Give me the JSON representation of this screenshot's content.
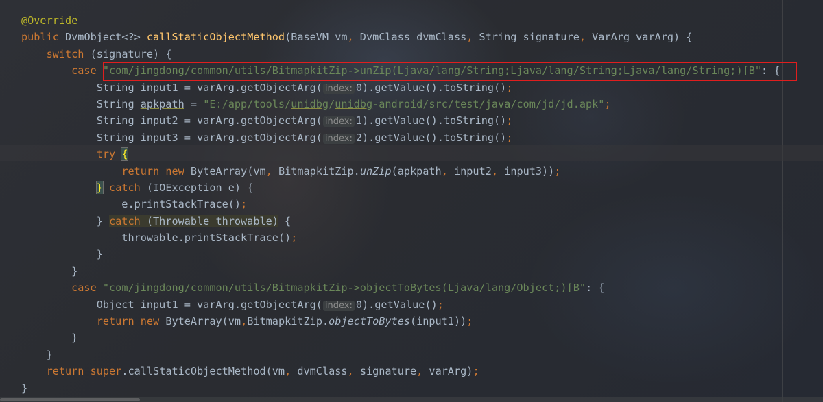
{
  "editor": {
    "language": "java",
    "current_line_index": 8,
    "highlighted_line_index": 3,
    "colors": {
      "keyword": "#cc7832",
      "string": "#6a8759",
      "method_declaration": "#ffc66d",
      "annotation": "#bbb529",
      "plain": "#a9b7c6",
      "param_hint_text": "#8d8d8d",
      "highlight_box": "#e01e1e"
    },
    "lines": [
      {
        "tokens": [
          {
            "t": "@Override",
            "c": "ann"
          }
        ]
      },
      {
        "tokens": [
          {
            "t": "public",
            "c": "kw"
          },
          {
            "t": " DvmObject<?> "
          },
          {
            "t": "callStaticObjectMethod",
            "c": "fn"
          },
          {
            "t": "(BaseVM vm"
          },
          {
            "t": ",",
            "c": "kw"
          },
          {
            "t": " DvmClass dvmClass"
          },
          {
            "t": ",",
            "c": "kw"
          },
          {
            "t": " String signature"
          },
          {
            "t": ",",
            "c": "kw"
          },
          {
            "t": " VarArg varArg) {"
          }
        ]
      },
      {
        "tokens": [
          {
            "t": "    "
          },
          {
            "t": "switch",
            "c": "kw"
          },
          {
            "t": " (signature) {"
          }
        ]
      },
      {
        "tokens": [
          {
            "t": "        "
          },
          {
            "t": "case",
            "c": "kw"
          },
          {
            "t": " "
          },
          {
            "t": "\"com/",
            "c": "str"
          },
          {
            "t": "jingdong",
            "c": "str sq"
          },
          {
            "t": "/common/utils/",
            "c": "str"
          },
          {
            "t": "BitmapkitZip",
            "c": "str sq"
          },
          {
            "t": "->unZip(",
            "c": "str"
          },
          {
            "t": "Ljava",
            "c": "str sq"
          },
          {
            "t": "/lang/String;",
            "c": "str"
          },
          {
            "t": "Ljava",
            "c": "str sq"
          },
          {
            "t": "/lang/String;",
            "c": "str"
          },
          {
            "t": "Ljava",
            "c": "str sq"
          },
          {
            "t": "/lang/String;)[B\"",
            "c": "str"
          },
          {
            "t": ": {"
          }
        ]
      },
      {
        "tokens": [
          {
            "t": "            String "
          },
          {
            "t": "input1",
            "c": "dim"
          },
          {
            "t": " = varArg.getObjectArg("
          },
          {
            "t": "index:",
            "c": "hint"
          },
          {
            "t": "0).getValue().toString()"
          },
          {
            "t": ";",
            "c": "kw"
          }
        ]
      },
      {
        "tokens": [
          {
            "t": "            String "
          },
          {
            "t": "apkpath",
            "c": "sq"
          },
          {
            "t": " = "
          },
          {
            "t": "\"E:/app/tools/",
            "c": "str"
          },
          {
            "t": "unidbg",
            "c": "str sq"
          },
          {
            "t": "/",
            "c": "str"
          },
          {
            "t": "unidbg",
            "c": "str sq"
          },
          {
            "t": "-android/src/test/java/com/jd/jd.apk\"",
            "c": "str"
          },
          {
            "t": ";",
            "c": "kw"
          }
        ]
      },
      {
        "tokens": [
          {
            "t": "            String input2 = varArg.getObjectArg("
          },
          {
            "t": "index:",
            "c": "hint"
          },
          {
            "t": "1).getValue().toString()"
          },
          {
            "t": ";",
            "c": "kw"
          }
        ]
      },
      {
        "tokens": [
          {
            "t": "            String input3 = varArg.getObjectArg("
          },
          {
            "t": "index:",
            "c": "hint"
          },
          {
            "t": "2).getValue().toString()"
          },
          {
            "t": ";",
            "c": "kw"
          }
        ]
      },
      {
        "tokens": [
          {
            "t": "            "
          },
          {
            "t": "try",
            "c": "kw"
          },
          {
            "t": " "
          },
          {
            "t": "{",
            "c": "brmatch"
          }
        ]
      },
      {
        "tokens": [
          {
            "t": "                "
          },
          {
            "t": "return",
            "c": "kw"
          },
          {
            "t": " "
          },
          {
            "t": "new",
            "c": "kw"
          },
          {
            "t": " ByteArray(vm"
          },
          {
            "t": ",",
            "c": "kw"
          },
          {
            "t": " BitmapkitZip."
          },
          {
            "t": "unZip",
            "c": "it"
          },
          {
            "t": "(apkpath"
          },
          {
            "t": ",",
            "c": "kw"
          },
          {
            "t": " input2"
          },
          {
            "t": ",",
            "c": "kw"
          },
          {
            "t": " input3))"
          },
          {
            "t": ";",
            "c": "kw"
          }
        ]
      },
      {
        "tokens": [
          {
            "t": "            "
          },
          {
            "t": "}",
            "c": "brmatch"
          },
          {
            "t": " "
          },
          {
            "t": "catch",
            "c": "kw"
          },
          {
            "t": " (IOException e) {"
          }
        ]
      },
      {
        "tokens": [
          {
            "t": "                e.printStackTrace()"
          },
          {
            "t": ";",
            "c": "kw"
          }
        ]
      },
      {
        "tokens": [
          {
            "t": "            } "
          },
          {
            "t": "catch",
            "c": "kw mark"
          },
          {
            "t": " (Throwable throwable)",
            "c": "mark"
          },
          {
            "t": " {"
          }
        ]
      },
      {
        "tokens": [
          {
            "t": "                throwable.printStackTrace()"
          },
          {
            "t": ";",
            "c": "kw"
          }
        ]
      },
      {
        "tokens": [
          {
            "t": "            }"
          }
        ]
      },
      {
        "tokens": [
          {
            "t": "        }"
          }
        ]
      },
      {
        "tokens": [
          {
            "t": "        "
          },
          {
            "t": "case",
            "c": "kw"
          },
          {
            "t": " "
          },
          {
            "t": "\"com/",
            "c": "str"
          },
          {
            "t": "jingdong",
            "c": "str sq"
          },
          {
            "t": "/common/utils/",
            "c": "str"
          },
          {
            "t": "BitmapkitZip",
            "c": "str sq"
          },
          {
            "t": "->objectToBytes(",
            "c": "str"
          },
          {
            "t": "Ljava",
            "c": "str sq"
          },
          {
            "t": "/lang/Object;)[B\"",
            "c": "str"
          },
          {
            "t": ": {"
          }
        ]
      },
      {
        "tokens": [
          {
            "t": "            Object input1 = varArg.getObjectArg("
          },
          {
            "t": "index:",
            "c": "hint"
          },
          {
            "t": "0).getValue()"
          },
          {
            "t": ";",
            "c": "kw"
          }
        ]
      },
      {
        "tokens": [
          {
            "t": "            "
          },
          {
            "t": "return",
            "c": "kw"
          },
          {
            "t": " "
          },
          {
            "t": "new",
            "c": "kw"
          },
          {
            "t": " ByteArray(vm"
          },
          {
            "t": ",",
            "c": "kw"
          },
          {
            "t": "BitmapkitZip."
          },
          {
            "t": "objectToBytes",
            "c": "it"
          },
          {
            "t": "(input1))"
          },
          {
            "t": ";",
            "c": "kw"
          }
        ]
      },
      {
        "tokens": [
          {
            "t": "        }"
          }
        ]
      },
      {
        "tokens": [
          {
            "t": "    }"
          }
        ]
      },
      {
        "tokens": [
          {
            "t": "    "
          },
          {
            "t": "return",
            "c": "kw"
          },
          {
            "t": " "
          },
          {
            "t": "super",
            "c": "kw"
          },
          {
            "t": ".callStaticObjectMethod(vm"
          },
          {
            "t": ",",
            "c": "kw"
          },
          {
            "t": " dvmClass"
          },
          {
            "t": ",",
            "c": "kw"
          },
          {
            "t": " signature"
          },
          {
            "t": ",",
            "c": "kw"
          },
          {
            "t": " varArg)"
          },
          {
            "t": ";",
            "c": "kw"
          }
        ]
      },
      {
        "tokens": [
          {
            "t": "}"
          }
        ]
      }
    ]
  }
}
